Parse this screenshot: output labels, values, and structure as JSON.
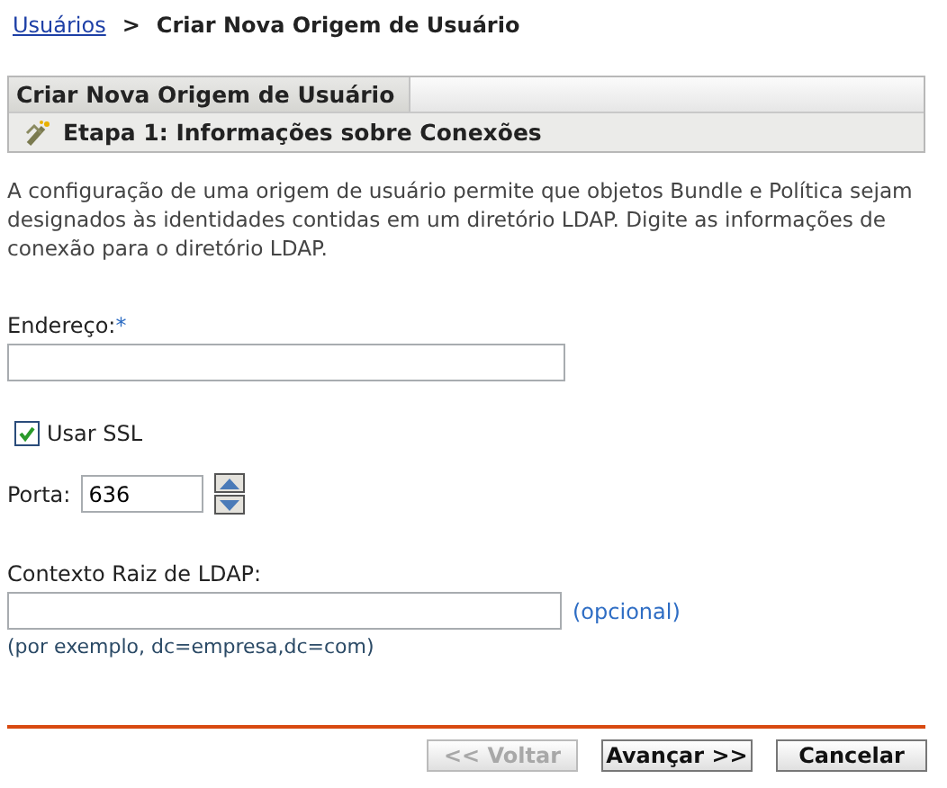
{
  "breadcrumb": {
    "link": "Usuários",
    "separator": ">",
    "current": "Criar Nova Origem de Usuário"
  },
  "panel": {
    "title": "Criar Nova Origem de Usuário",
    "step": "Etapa 1: Informações sobre Conexões"
  },
  "description": "A configuração de uma origem de usuário permite que objetos Bundle e Política sejam designados às identidades contidas em um diretório LDAP. Digite as informações de conexão para o diretório LDAP.",
  "address": {
    "label": "Endereço:",
    "required_mark": "*"
  },
  "ssl": {
    "label": "Usar SSL",
    "checked": true
  },
  "port": {
    "label": "Porta:",
    "value": "636"
  },
  "ldap_context": {
    "label": "Contexto Raiz de LDAP:",
    "optional": "(opcional)",
    "hint": "(por exemplo, dc=empresa,dc=com)"
  },
  "buttons": [
    {
      "label": "<< Voltar",
      "disabled": true
    },
    {
      "label": "Avançar >>",
      "disabled": false
    },
    {
      "label": "Cancelar",
      "disabled": false
    }
  ]
}
